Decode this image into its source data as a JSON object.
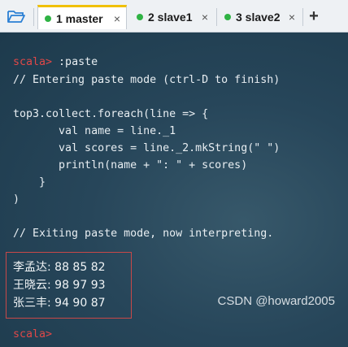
{
  "tabs": [
    {
      "label": "1 master",
      "close": "×",
      "active": true
    },
    {
      "label": "2 slave1",
      "close": "×",
      "active": false
    },
    {
      "label": "3 slave2",
      "close": "×",
      "active": false
    }
  ],
  "add_tab": "+",
  "terminal": {
    "prompt": "scala>",
    "lines": [
      " :paste",
      "// Entering paste mode (ctrl-D to finish)",
      "top3.collect.foreach(line => {",
      "       val name = line._1",
      "       val scores = line._2.mkString(\" \")",
      "       println(name + \": \" + scores)",
      "    }",
      ")",
      "// Exiting paste mode, now interpreting."
    ],
    "results": [
      "李孟达: 88 85 82",
      "王晓云: 98 97 93",
      "张三丰: 94 90 87"
    ]
  },
  "watermark": "CSDN @howard2005",
  "colors": {
    "prompt": "#e04848",
    "tab_dot": "#2fb344",
    "active_tab_accent": "#f0c000",
    "terminal_bg": "#27465a"
  }
}
